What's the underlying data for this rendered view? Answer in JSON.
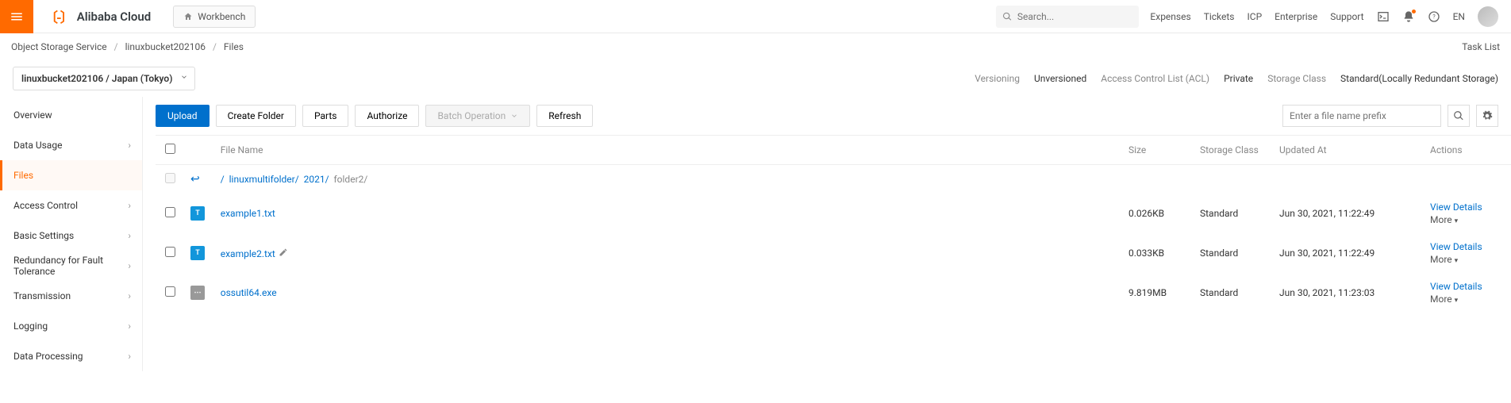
{
  "top": {
    "brand": "Alibaba Cloud",
    "workbench": "Workbench",
    "search_placeholder": "Search...",
    "links": [
      "Expenses",
      "Tickets",
      "ICP",
      "Enterprise",
      "Support"
    ],
    "lang": "EN"
  },
  "breadcrumb": {
    "root": "Object Storage Service",
    "bucket": "linuxbucket202106",
    "page": "Files",
    "tasklist": "Task List"
  },
  "region_selector": "linuxbucket202106 / Japan (Tokyo)",
  "meta": {
    "versioning_label": "Versioning",
    "versioning_value": "Unversioned",
    "acl_label": "Access Control List (ACL)",
    "acl_value": "Private",
    "storage_label": "Storage Class",
    "storage_value": "Standard(Locally Redundant Storage)"
  },
  "sidebar": [
    {
      "label": "Overview",
      "arrow": false
    },
    {
      "label": "Data Usage",
      "arrow": true
    },
    {
      "label": "Files",
      "arrow": false,
      "active": true
    },
    {
      "label": "Access Control",
      "arrow": true
    },
    {
      "label": "Basic Settings",
      "arrow": true
    },
    {
      "label": "Redundancy for Fault Tolerance",
      "arrow": true
    },
    {
      "label": "Transmission",
      "arrow": true
    },
    {
      "label": "Logging",
      "arrow": true
    },
    {
      "label": "Data Processing",
      "arrow": true
    }
  ],
  "toolbar": {
    "upload": "Upload",
    "create_folder": "Create Folder",
    "parts": "Parts",
    "authorize": "Authorize",
    "batch": "Batch Operation",
    "refresh": "Refresh",
    "filter_placeholder": "Enter a file name prefix"
  },
  "table": {
    "headers": {
      "name": "File Name",
      "size": "Size",
      "class": "Storage Class",
      "updated": "Updated At",
      "actions": "Actions"
    },
    "path_root": "/",
    "path_seg1": "linuxmultifolder/",
    "path_seg2": "2021/",
    "path_current": "folder2/",
    "view_details": "View Details",
    "more": "More",
    "rows": [
      {
        "name": "example1.txt",
        "icon": "txt",
        "size": "0.026KB",
        "class": "Standard",
        "updated": "Jun 30, 2021, 11:22:49",
        "edit": false
      },
      {
        "name": "example2.txt",
        "icon": "txt",
        "size": "0.033KB",
        "class": "Standard",
        "updated": "Jun 30, 2021, 11:22:49",
        "edit": true
      },
      {
        "name": "ossutil64.exe",
        "icon": "exe",
        "size": "9.819MB",
        "class": "Standard",
        "updated": "Jun 30, 2021, 11:23:03",
        "edit": false
      }
    ]
  }
}
